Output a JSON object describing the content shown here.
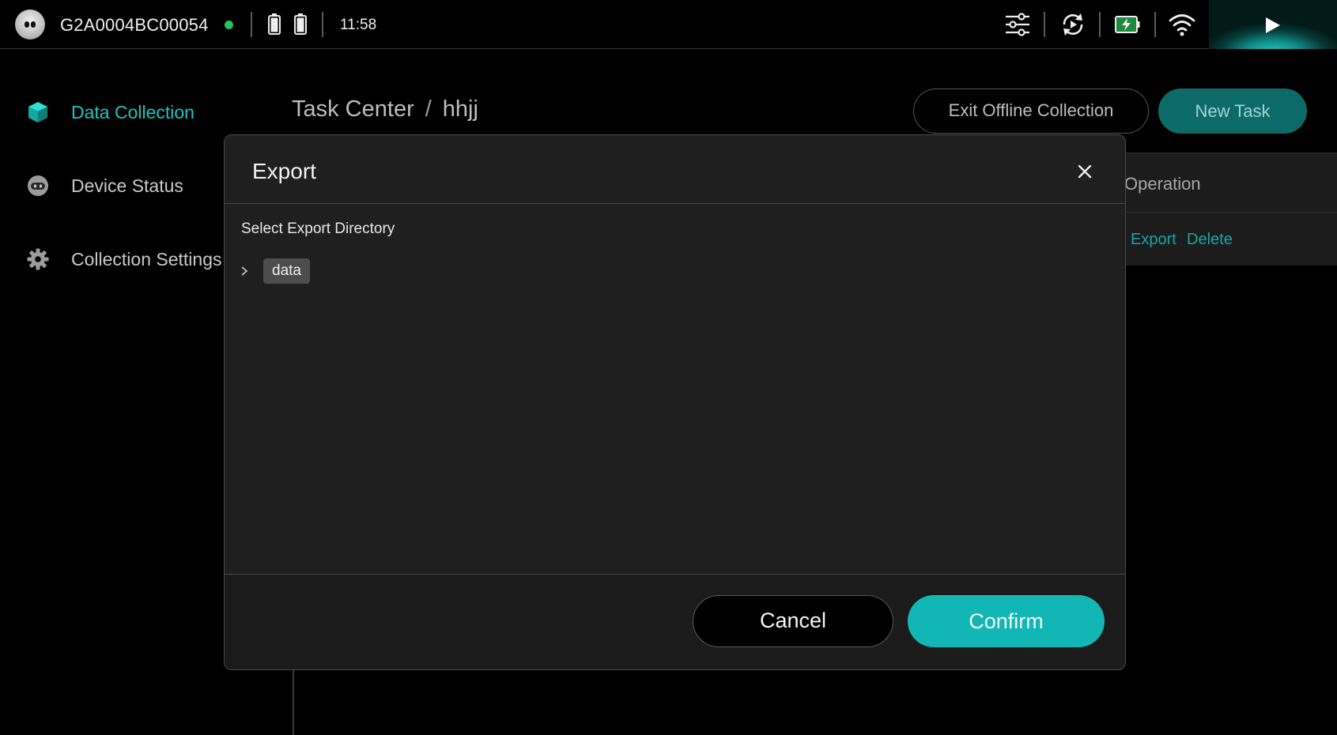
{
  "statusbar": {
    "device_id": "G2A0004BC00054",
    "time": "11:58",
    "online_color": "#22c55e",
    "icons": [
      "robot-avatar",
      "battery-icon",
      "battery-icon",
      "sliders-icon",
      "rotate-icon",
      "charging-battery-icon",
      "wifi-icon",
      "play-icon"
    ]
  },
  "sidebar": {
    "items": [
      {
        "label": "Data Collection",
        "icon": "cube-icon",
        "active": true
      },
      {
        "label": "Device Status",
        "icon": "robot-icon",
        "active": false
      },
      {
        "label": "Collection Settings",
        "icon": "gear-icon",
        "active": false
      }
    ]
  },
  "header": {
    "breadcrumb_root": "Task Center",
    "breadcrumb_sep": "/",
    "breadcrumb_current": "hhjj",
    "exit_offline_label": "Exit Offline Collection",
    "new_task_label": "New Task"
  },
  "table": {
    "operation_header": "Operation",
    "row_actions": [
      "Export",
      "Delete"
    ]
  },
  "dialog": {
    "title": "Export",
    "directory_label": "Select Export Directory",
    "tree": [
      {
        "label": "data",
        "expanded": false
      }
    ],
    "cancel_label": "Cancel",
    "confirm_label": "Confirm"
  },
  "colors": {
    "accent": "#1fc3c3",
    "confirm": "#12b7b5",
    "new_task_bg": "#0c6b69",
    "link": "#1aa7a5"
  }
}
